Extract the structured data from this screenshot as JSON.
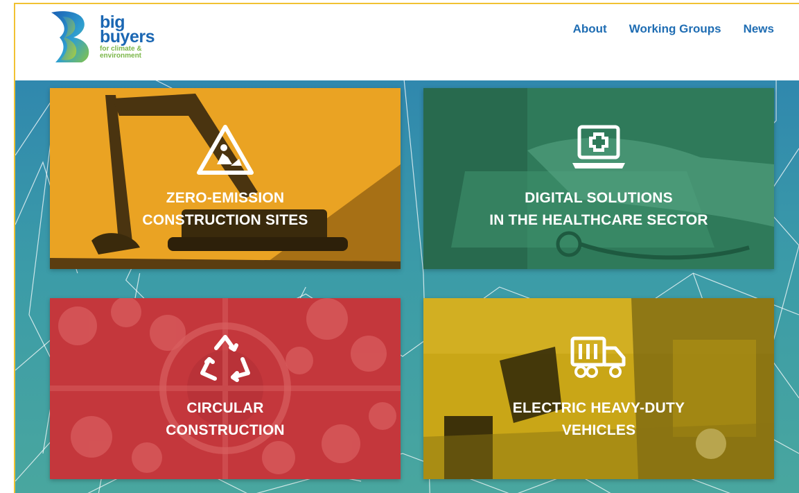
{
  "logo": {
    "word1": "big",
    "word2": "buyers",
    "tagline1": "for climate &",
    "tagline2": "environment"
  },
  "nav": {
    "items": [
      "About",
      "Working Groups",
      "News"
    ]
  },
  "cards": [
    {
      "line1": "ZERO-EMISSION",
      "line2": "CONSTRUCTION SITES",
      "icon": "construction-worker-icon",
      "color": "#e8a21c"
    },
    {
      "line1": "DIGITAL SOLUTIONS",
      "line2": "IN THE HEALTHCARE SECTOR",
      "icon": "laptop-medical-icon",
      "color": "#2e7c5a"
    },
    {
      "line1": "CIRCULAR",
      "line2": "CONSTRUCTION",
      "icon": "recycle-icon",
      "color": "#c8333a"
    },
    {
      "line1": "ELECTRIC HEAVY-DUTY",
      "line2": "VEHICLES",
      "icon": "truck-icon",
      "color": "#c7a616"
    }
  ],
  "colors": {
    "brand_blue": "#1f6db3",
    "brand_green": "#7ab648",
    "hero_teal": "#3b9ba8"
  }
}
